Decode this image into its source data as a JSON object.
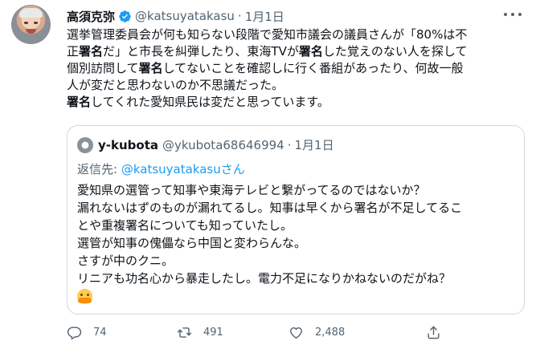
{
  "tweet": {
    "author": {
      "display_name": "高須克弥",
      "handle": "@katsuyatakasu",
      "verified": true,
      "time": "1月1日"
    },
    "body_lines": [
      "選挙管理委員会が何も知らない段階で愛知市議会の議員さんが「80%は不",
      "正署名だ」と市長を糾弾したり、東海TVが署名した覚えのない人を探して",
      "個別訪問して署名してないことを確認しに行く番組があったり、何故一般",
      "人が変だと思わないのか不思議だった。",
      "署名してくれた愛知県民は変だと思っています。"
    ],
    "more_icon": "more-horizontal-icon"
  },
  "quote": {
    "display_name": "y-kubota",
    "handle": "@ykubota68646994",
    "time": "1月1日",
    "reply_prefix": "返信先: ",
    "reply_mention": "@katsuyatakasuさん",
    "lines": [
      "愛知県の選管って知事や東海テレビと繋がってるのではないか？",
      "漏れないはずのものが漏れてるし。知事は早くから署名が不足してるこ",
      "とや重複署名についても知っていたし。",
      "選管が知事の傀儡なら中国と変わらんな。",
      "さすが中のクニ。",
      "リニアも功名心から暴走したし。電力不足になりかねないのだがね？"
    ],
    "emoji": "hugging-face-emoji"
  },
  "actions": {
    "reply_count": "74",
    "retweet_count": "491",
    "like_count": "2,488"
  },
  "colors": {
    "text": "#0f1419",
    "secondary": "#536471",
    "accent": "#1d9bf0",
    "border": "#cfd9de"
  }
}
